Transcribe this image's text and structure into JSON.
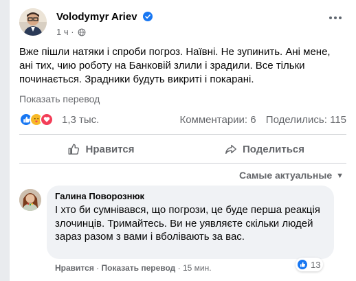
{
  "post": {
    "author": "Volodymyr Ariev",
    "time": "1 ч",
    "text": "Вже пішли натяки і спроби погроз. Наївні. Не зупинить. Ані мене, ані тих, чию роботу на Банковій злили і зрадили. Все тільки починається. Зрадники будуть викриті і покарані.",
    "translate_label": "Показать перевод",
    "icons": [
      "verified-badge-icon",
      "globe-icon",
      "more-icon"
    ]
  },
  "stats": {
    "reaction_count": "1,3 тыс.",
    "comments": "Комментарии: 6",
    "shares": "Поделились: 115",
    "reaction_types": [
      "like",
      "care",
      "love"
    ]
  },
  "actions": {
    "like_label": "Нравится",
    "share_label": "Поделиться"
  },
  "comments": {
    "sort_label": "Самые актуальные",
    "items": [
      {
        "author": "Галина Поворознюк",
        "text": "І хто би сумнівався, що погрози, це буде перша реакція злочинців. Тримайтесь. Ви не уявляєте скільки людей зараз разом з вами і вболівають за вас.",
        "like_label": "Нравится",
        "translate_label": "Показать перевод",
        "time": "15 мин.",
        "reaction_count": "13"
      }
    ]
  },
  "colors": {
    "accent": "#1877f2",
    "muted_text": "#65676b",
    "bubble_bg": "#f0f2f5",
    "divider": "#ced0d4"
  }
}
